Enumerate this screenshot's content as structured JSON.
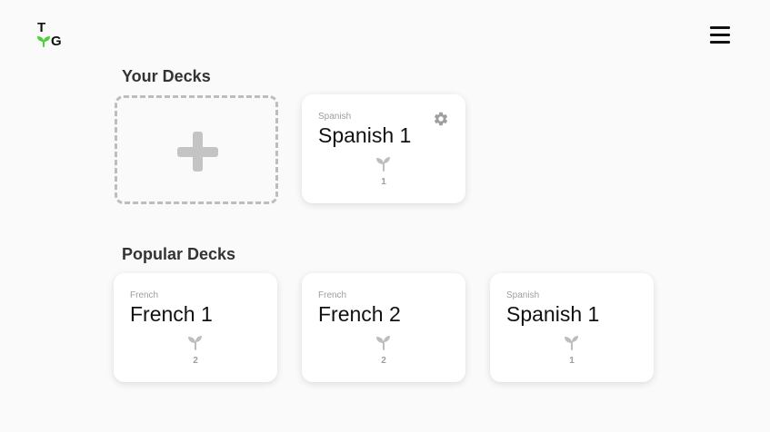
{
  "brand": {
    "logo_top": "T",
    "logo_bottom": "G",
    "accent_color": "#4cd137"
  },
  "header": {
    "menu_icon": "hamburger-menu-icon"
  },
  "your_decks": {
    "title": "Your Decks",
    "add_icon": "plus-icon",
    "items": [
      {
        "language": "Spanish",
        "name": "Spanish 1",
        "count": "1",
        "icon": "sprout-icon",
        "settings_icon": "gear-icon"
      }
    ]
  },
  "popular_decks": {
    "title": "Popular Decks",
    "items": [
      {
        "language": "French",
        "name": "French 1",
        "count": "2",
        "icon": "sprout-icon"
      },
      {
        "language": "French",
        "name": "French 2",
        "count": "2",
        "icon": "sprout-icon"
      },
      {
        "language": "Spanish",
        "name": "Spanish 1",
        "count": "1",
        "icon": "sprout-icon"
      }
    ]
  }
}
